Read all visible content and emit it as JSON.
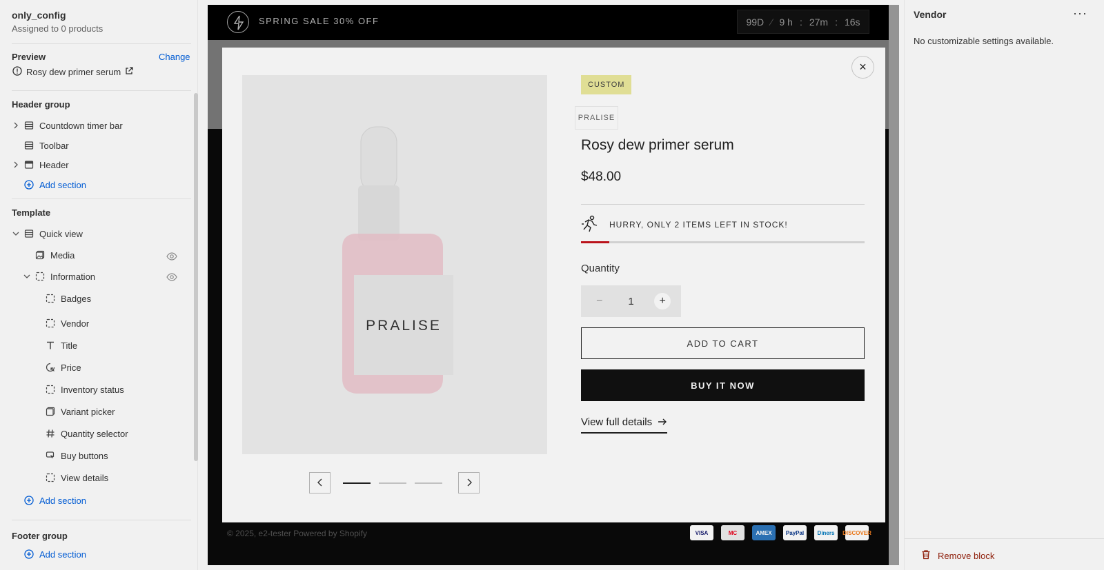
{
  "left_panel": {
    "config_title": "only_config",
    "config_sub": "Assigned to 0 products",
    "preview_label": "Preview",
    "change_label": "Change",
    "preview_product": "Rosy dew primer serum",
    "header_group": "Header group",
    "header_items": [
      "Countdown timer bar",
      "Toolbar",
      "Header"
    ],
    "add_section": "Add section",
    "template_label": "Template",
    "quick_view": "Quick view",
    "media": "Media",
    "information": "Information",
    "info_blocks": [
      "Badges",
      "Vendor",
      "Title",
      "Price",
      "Inventory status",
      "Variant picker",
      "Quantity selector",
      "Buy buttons",
      "View details"
    ],
    "footer_group": "Footer group"
  },
  "preview": {
    "announcement": "SPRING SALE 30% OFF",
    "timer": {
      "days": "99D",
      "sep": "∕",
      "hours": "9 h",
      "minutes": "27m",
      "seconds": "16s",
      "colon": ":"
    },
    "badge": "CUSTOM",
    "vendor": "PRALISE",
    "image_brand": "PRALISE",
    "product_title": "Rosy dew primer serum",
    "price": "$48.00",
    "stock_text": "HURRY, ONLY 2 ITEMS LEFT IN STOCK!",
    "stock_level": 0.1,
    "quantity_label": "Quantity",
    "quantity_value": "1",
    "minus": "−",
    "plus": "+",
    "add_to_cart": "ADD TO CART",
    "buy_now": "BUY IT NOW",
    "view_details": "View full details",
    "close": "×",
    "footer_copy": "© 2025, e2-tester Powered by Shopify",
    "payments": [
      "VISA",
      "MC",
      "AMEX",
      "PayPal",
      "Diners",
      "DISCOVER"
    ]
  },
  "right_panel": {
    "title": "Vendor",
    "more": "···",
    "message": "No customizable settings available.",
    "remove_block": "Remove block"
  },
  "colors": {
    "accent": "#005bd3",
    "stock_red": "#c4141c",
    "danger": "#8e1f0b",
    "badge": "#ecea9e"
  }
}
